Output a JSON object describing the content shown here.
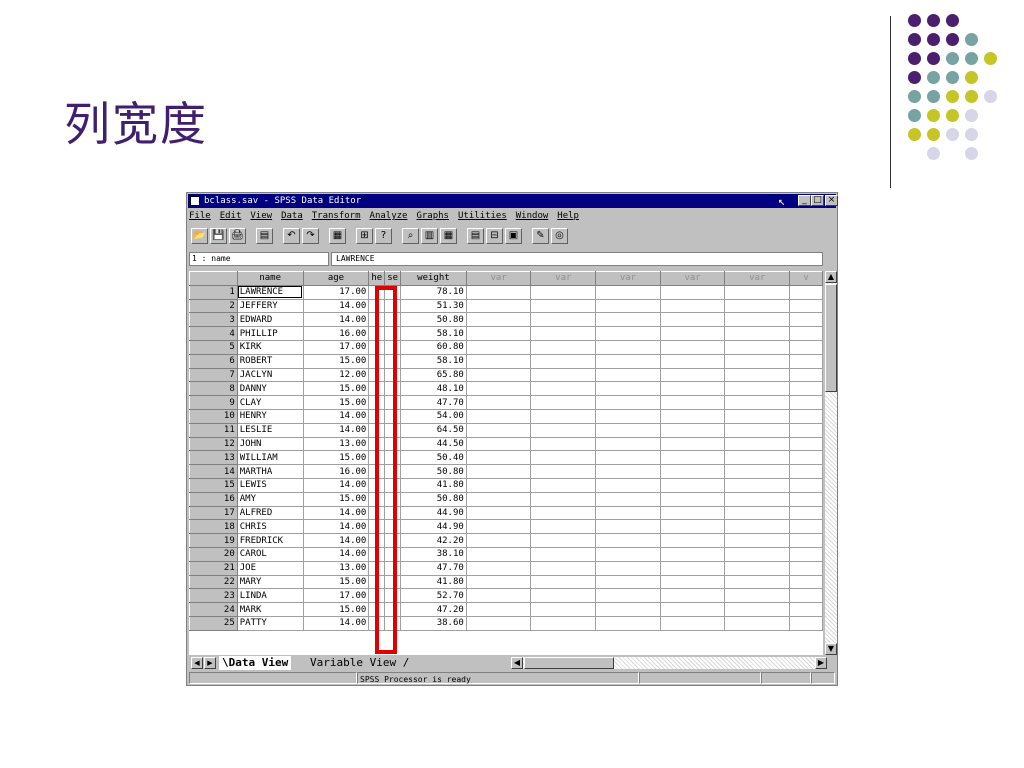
{
  "slide": {
    "title": "列宽度"
  },
  "decor": {
    "colors": {
      "purple": "#4b1e6e",
      "teal": "#77a3a3",
      "olive": "#c5c528",
      "lavender": "#d6d6e8"
    },
    "dots": [
      [
        "purple",
        "purple",
        "purple",
        null,
        null
      ],
      [
        "purple",
        "purple",
        "purple",
        "teal",
        null
      ],
      [
        "purple",
        "purple",
        "teal",
        "teal",
        "olive"
      ],
      [
        "purple",
        "teal",
        "teal",
        "olive",
        null
      ],
      [
        "teal",
        "teal",
        "olive",
        "olive",
        "lavender"
      ],
      [
        "teal",
        "olive",
        "olive",
        "lavender",
        null
      ],
      [
        "olive",
        "olive",
        "lavender",
        "lavender",
        null
      ],
      [
        null,
        "lavender",
        null,
        "lavender",
        null
      ]
    ]
  },
  "window": {
    "title": "bclass.sav - SPSS Data Editor",
    "controls": {
      "minimize": "_",
      "maximize": "□",
      "close": "×"
    },
    "cursor": "↖",
    "menu": [
      "File",
      "Edit",
      "View",
      "Data",
      "Transform",
      "Analyze",
      "Graphs",
      "Utilities",
      "Window",
      "Help"
    ],
    "toolbar": [
      "📂",
      "💾",
      "🖨",
      "▤",
      "↶",
      "↷",
      "▦",
      "⊞",
      "?",
      "⌕",
      "▥",
      "▦",
      "▤",
      "⊟",
      "▣",
      "✎",
      "◎"
    ],
    "cell_ref": "1 : name",
    "cell_value": "LAWRENCE",
    "columns": [
      "name",
      "age",
      "he",
      "se",
      "weight",
      "var",
      "var",
      "var",
      "var",
      "var",
      "v"
    ],
    "rows": [
      {
        "n": "1",
        "name": "LAWRENCE",
        "age": "17.00",
        "weight": "78.10"
      },
      {
        "n": "2",
        "name": "JEFFERY",
        "age": "14.00",
        "weight": "51.30"
      },
      {
        "n": "3",
        "name": "EDWARD",
        "age": "14.00",
        "weight": "50.80"
      },
      {
        "n": "4",
        "name": "PHILLIP",
        "age": "16.00",
        "weight": "58.10"
      },
      {
        "n": "5",
        "name": "KIRK",
        "age": "17.00",
        "weight": "60.80"
      },
      {
        "n": "6",
        "name": "ROBERT",
        "age": "15.00",
        "weight": "58.10"
      },
      {
        "n": "7",
        "name": "JACLYN",
        "age": "12.00",
        "weight": "65.80"
      },
      {
        "n": "8",
        "name": "DANNY",
        "age": "15.00",
        "weight": "48.10"
      },
      {
        "n": "9",
        "name": "CLAY",
        "age": "15.00",
        "weight": "47.70"
      },
      {
        "n": "10",
        "name": "HENRY",
        "age": "14.00",
        "weight": "54.00"
      },
      {
        "n": "11",
        "name": "LESLIE",
        "age": "14.00",
        "weight": "64.50"
      },
      {
        "n": "12",
        "name": "JOHN",
        "age": "13.00",
        "weight": "44.50"
      },
      {
        "n": "13",
        "name": "WILLIAM",
        "age": "15.00",
        "weight": "50.40"
      },
      {
        "n": "14",
        "name": "MARTHA",
        "age": "16.00",
        "weight": "50.80"
      },
      {
        "n": "15",
        "name": "LEWIS",
        "age": "14.00",
        "weight": "41.80"
      },
      {
        "n": "16",
        "name": "AMY",
        "age": "15.00",
        "weight": "50.80"
      },
      {
        "n": "17",
        "name": "ALFRED",
        "age": "14.00",
        "weight": "44.90"
      },
      {
        "n": "18",
        "name": "CHRIS",
        "age": "14.00",
        "weight": "44.90"
      },
      {
        "n": "19",
        "name": "FREDRICK",
        "age": "14.00",
        "weight": "42.20"
      },
      {
        "n": "20",
        "name": "CAROL",
        "age": "14.00",
        "weight": "38.10"
      },
      {
        "n": "21",
        "name": "JOE",
        "age": "13.00",
        "weight": "47.70"
      },
      {
        "n": "22",
        "name": "MARY",
        "age": "15.00",
        "weight": "41.80"
      },
      {
        "n": "23",
        "name": "LINDA",
        "age": "17.00",
        "weight": "52.70"
      },
      {
        "n": "24",
        "name": "MARK",
        "age": "15.00",
        "weight": "47.20"
      },
      {
        "n": "25",
        "name": "PATTY",
        "age": "14.00",
        "weight": "38.60"
      }
    ],
    "tabs": {
      "data_view": "\\Data View",
      "variable_view": "Variable View /"
    },
    "status": "SPSS Processor  is ready"
  }
}
